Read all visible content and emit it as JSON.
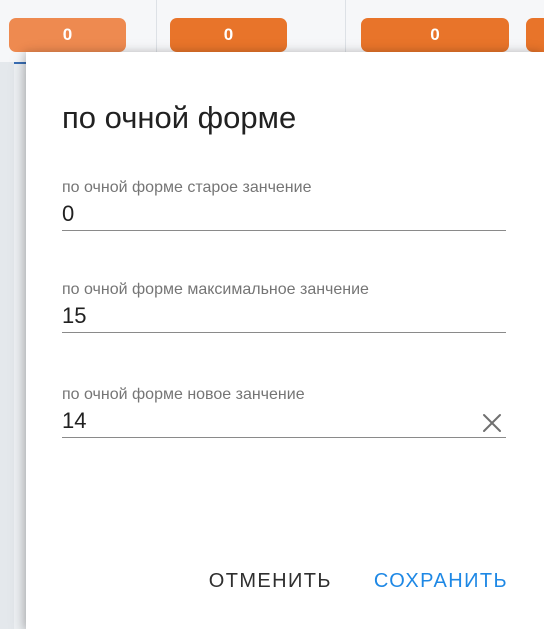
{
  "background": {
    "badges": [
      "0",
      "0",
      "0",
      ""
    ],
    "badge_color": "#e8742a"
  },
  "dialog": {
    "title": "по очной форме",
    "fields": [
      {
        "label": "по очной форме старое занчение",
        "value": "0"
      },
      {
        "label": "по очной форме максимальное занчение",
        "value": "15"
      },
      {
        "label": "по очной форме новое занчение",
        "value": "14",
        "clear_icon": "close-icon"
      }
    ],
    "actions": {
      "cancel_label": "ОТМЕНИТЬ",
      "save_label": "СОХРАНИТЬ"
    },
    "accent_color": "#1e88e5"
  }
}
